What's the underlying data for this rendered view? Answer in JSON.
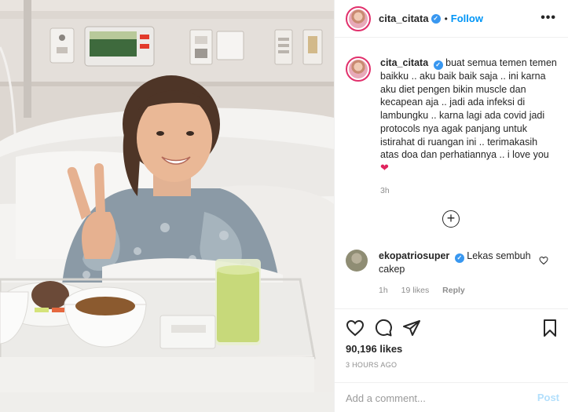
{
  "post": {
    "author": "cita_citata",
    "follow_label": "Follow",
    "dot": "•",
    "more_label": "•••",
    "caption": {
      "username": "cita_citata",
      "text": "buat semua temen temen baikku .. aku baik baik saja .. ini karna aku diet pengen bikin muscle dan kecapean aja .. jadi ada infeksi di lambungku .. karna lagi ada covid jadi protocols nya agak panjang untuk istirahat di ruangan ini .. terimakasih atas doa dan perhatiannya .. i love you",
      "emoji": "❤",
      "time": "3h"
    },
    "load_more_icon": "plus-circle-icon",
    "comments": [
      {
        "username": "ekopatriosuper",
        "text": "Lekas sembuh cakep",
        "time": "1h",
        "likes": "19 likes",
        "reply_label": "Reply"
      }
    ],
    "actions": {
      "like_icon": "heart-icon",
      "comment_icon": "comment-icon",
      "share_icon": "paper-plane-icon",
      "save_icon": "bookmark-icon"
    },
    "likes": "90,196 likes",
    "posted_ago": "3 HOURS AGO",
    "add_comment": {
      "placeholder": "Add a comment...",
      "post_label": "Post"
    }
  },
  "colors": {
    "link_blue": "#0095f6",
    "verified_blue": "#3897f0",
    "post_disabled": "#b2dffc",
    "muted": "#8e8e8e",
    "heart_red": "#e0245e"
  }
}
